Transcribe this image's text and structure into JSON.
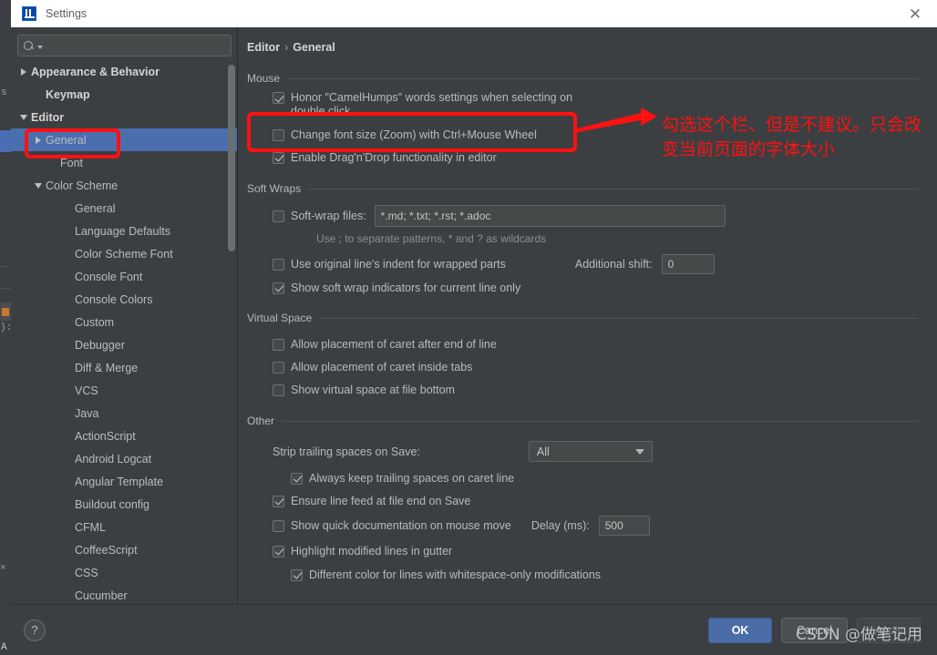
{
  "window": {
    "title": "Settings",
    "app_icon": "intellij-idea-icon",
    "close_label": "✕"
  },
  "sidebar": {
    "search": {
      "placeholder": "",
      "value": "",
      "icon": "search-icon"
    },
    "items": [
      {
        "label": "Appearance & Behavior",
        "twisty": "right",
        "indent": 0,
        "bold": true,
        "selected": false
      },
      {
        "label": "Keymap",
        "twisty": "none",
        "indent": 1,
        "bold": true,
        "selected": false
      },
      {
        "label": "Editor",
        "twisty": "down",
        "indent": 0,
        "bold": true,
        "selected": false
      },
      {
        "label": "General",
        "twisty": "right",
        "indent": 1,
        "bold": false,
        "selected": true
      },
      {
        "label": "Font",
        "twisty": "none",
        "indent": 2,
        "bold": false,
        "selected": false
      },
      {
        "label": "Color Scheme",
        "twisty": "down",
        "indent": 1,
        "bold": false,
        "selected": false
      },
      {
        "label": "General",
        "twisty": "none",
        "indent": 3,
        "bold": false,
        "selected": false
      },
      {
        "label": "Language Defaults",
        "twisty": "none",
        "indent": 3,
        "bold": false,
        "selected": false
      },
      {
        "label": "Color Scheme Font",
        "twisty": "none",
        "indent": 3,
        "bold": false,
        "selected": false
      },
      {
        "label": "Console Font",
        "twisty": "none",
        "indent": 3,
        "bold": false,
        "selected": false
      },
      {
        "label": "Console Colors",
        "twisty": "none",
        "indent": 3,
        "bold": false,
        "selected": false
      },
      {
        "label": "Custom",
        "twisty": "none",
        "indent": 3,
        "bold": false,
        "selected": false
      },
      {
        "label": "Debugger",
        "twisty": "none",
        "indent": 3,
        "bold": false,
        "selected": false
      },
      {
        "label": "Diff & Merge",
        "twisty": "none",
        "indent": 3,
        "bold": false,
        "selected": false
      },
      {
        "label": "VCS",
        "twisty": "none",
        "indent": 3,
        "bold": false,
        "selected": false
      },
      {
        "label": "Java",
        "twisty": "none",
        "indent": 3,
        "bold": false,
        "selected": false
      },
      {
        "label": "ActionScript",
        "twisty": "none",
        "indent": 3,
        "bold": false,
        "selected": false
      },
      {
        "label": "Android Logcat",
        "twisty": "none",
        "indent": 3,
        "bold": false,
        "selected": false
      },
      {
        "label": "Angular Template",
        "twisty": "none",
        "indent": 3,
        "bold": false,
        "selected": false
      },
      {
        "label": "Buildout config",
        "twisty": "none",
        "indent": 3,
        "bold": false,
        "selected": false
      },
      {
        "label": "CFML",
        "twisty": "none",
        "indent": 3,
        "bold": false,
        "selected": false
      },
      {
        "label": "CoffeeScript",
        "twisty": "none",
        "indent": 3,
        "bold": false,
        "selected": false
      },
      {
        "label": "CSS",
        "twisty": "none",
        "indent": 3,
        "bold": false,
        "selected": false
      },
      {
        "label": "Cucumber",
        "twisty": "none",
        "indent": 3,
        "bold": false,
        "selected": false
      }
    ]
  },
  "breadcrumb": {
    "root": "Editor",
    "separator": "›",
    "leaf": "General"
  },
  "sections": {
    "mouse": {
      "title": "Mouse",
      "options": [
        {
          "label": "Honor \"CamelHumps\" words settings when selecting on double click",
          "checked": true
        },
        {
          "label": "Change font size (Zoom) with Ctrl+Mouse Wheel",
          "checked": false
        },
        {
          "label": "Enable Drag'n'Drop functionality in editor",
          "checked": true
        }
      ]
    },
    "soft_wraps": {
      "title": "Soft Wraps",
      "softwrap_files_label": "Soft-wrap files:",
      "softwrap_files_checked": false,
      "softwrap_files_value": "*.md; *.txt; *.rst; *.adoc",
      "hint": "Use ; to separate patterns, * and ? as wildcards",
      "use_original_indent_label": "Use original line's indent for wrapped parts",
      "use_original_indent_checked": false,
      "additional_shift_label": "Additional shift:",
      "additional_shift_value": "0",
      "show_indicators_label": "Show soft wrap indicators for current line only",
      "show_indicators_checked": true
    },
    "virtual_space": {
      "title": "Virtual Space",
      "options": [
        {
          "label": "Allow placement of caret after end of line",
          "checked": false
        },
        {
          "label": "Allow placement of caret inside tabs",
          "checked": false
        },
        {
          "label": "Show virtual space at file bottom",
          "checked": false
        }
      ]
    },
    "other": {
      "title": "Other",
      "strip_trailing_label": "Strip trailing spaces on Save:",
      "strip_trailing_value": "All",
      "strip_trailing_options": [
        "All"
      ],
      "always_keep_label": "Always keep trailing spaces on caret line",
      "always_keep_checked": true,
      "ensure_linefeed_label": "Ensure line feed at file end on Save",
      "ensure_linefeed_checked": true,
      "quick_doc_label": "Show quick documentation on mouse move",
      "quick_doc_checked": false,
      "delay_label": "Delay (ms):",
      "delay_value": "500",
      "highlight_modified_label": "Highlight modified lines in gutter",
      "highlight_modified_checked": true,
      "different_color_label": "Different color for lines with whitespace-only modifications",
      "different_color_checked": true
    }
  },
  "footer": {
    "help_label": "?",
    "ok_label": "OK",
    "cancel_label": "Cancel",
    "apply_label": "Apply"
  },
  "annotations": {
    "note_text": "勾选这个栏、但是不建议。只会改变当前页面的字体大小",
    "color": "#fe1111"
  },
  "watermark": {
    "text": "CSDN @做笔记用"
  }
}
